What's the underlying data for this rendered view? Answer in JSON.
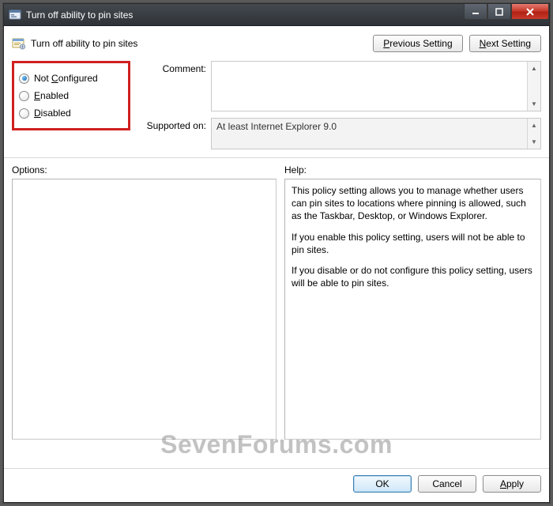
{
  "window": {
    "title": "Turn off ability to pin sites"
  },
  "header": {
    "policy_name": "Turn off ability to pin sites"
  },
  "nav": {
    "prev": "revious Setting",
    "prev_u": "P",
    "next_u": "N",
    "next": "ext Setting"
  },
  "state": {
    "options": {
      "not_configured": {
        "u": "C",
        "pre": "Not ",
        "post": "onfigured"
      },
      "enabled": {
        "u": "E",
        "post": "nabled"
      },
      "disabled": {
        "u": "D",
        "post": "isabled"
      }
    },
    "selected": "not_configured"
  },
  "labels": {
    "comment": "Comment:",
    "supported": "Supported on:",
    "options": "Options:",
    "help": "Help:"
  },
  "comment": "",
  "supported_on": "At least Internet Explorer 9.0",
  "help": {
    "p1": "This policy setting allows you to manage whether users can pin sites to locations where pinning is allowed, such as the Taskbar, Desktop, or Windows Explorer.",
    "p2": "If you enable this policy setting, users will not be able to pin sites.",
    "p3": "If you disable or do not configure this policy setting, users will be able to pin sites."
  },
  "buttons": {
    "ok": "OK",
    "cancel": "Cancel",
    "apply_u": "A",
    "apply": "pply"
  },
  "watermark": "SevenForums.com"
}
